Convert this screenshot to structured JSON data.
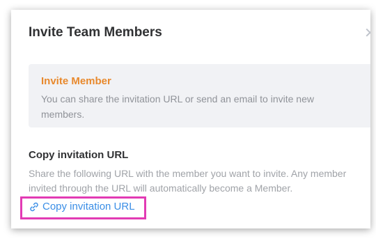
{
  "dialog": {
    "title": "Invite Team Members",
    "close_icon": "close-icon"
  },
  "info": {
    "title": "Invite Member",
    "text": "You can share the invitation URL or send an email to invite new members."
  },
  "copy_section": {
    "title": "Copy invitation URL",
    "description": "Share the following URL with the member you want to invite. Any member invited through the URL will automatically become a Member.",
    "link_label": "Copy invitation URL",
    "link_icon": "link-icon"
  },
  "colors": {
    "accent_orange": "#e8892d",
    "link_blue": "#3a8ee6",
    "highlight": "#e23bb4"
  }
}
